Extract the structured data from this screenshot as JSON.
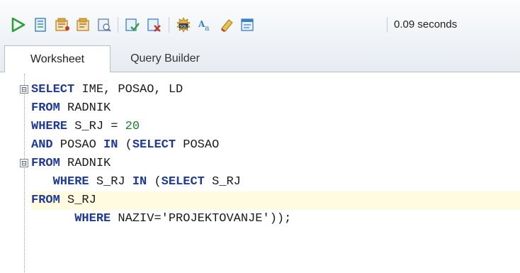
{
  "toolbar": {
    "buttons": [
      {
        "name": "run-statement-icon",
        "color": "#2f9e3a"
      },
      {
        "name": "run-script-icon",
        "color": "#3b7fc4"
      },
      {
        "name": "autotrace-icon",
        "color": "#c9962b"
      },
      {
        "name": "explain-plan-icon",
        "color": "#c9962b"
      },
      {
        "name": "sql-tuning-icon",
        "color": "#5f7fa8"
      },
      {
        "name": "commit-icon",
        "color": "#3b7fc4"
      },
      {
        "name": "rollback-icon",
        "color": "#c0392b"
      },
      {
        "name": "sql-history-icon",
        "color": "#c9962b"
      },
      {
        "name": "to-upper-lower-icon",
        "color": "#3b7fc4"
      },
      {
        "name": "clear-icon",
        "color": "#d4a12a"
      },
      {
        "name": "unshared-worksheet-icon",
        "color": "#3b7fc4"
      }
    ],
    "elapsed": "0.09 seconds"
  },
  "tabs": [
    {
      "label": "Worksheet",
      "active": true
    },
    {
      "label": "Query Builder",
      "active": false
    }
  ],
  "editor": {
    "lines": [
      [
        {
          "t": "SELECT",
          "c": "kw"
        },
        {
          "t": " IME, POSAO, LD",
          "c": "id"
        }
      ],
      [
        {
          "t": "FROM",
          "c": "kw"
        },
        {
          "t": " RADNIK",
          "c": "id"
        }
      ],
      [
        {
          "t": "WHERE",
          "c": "kw"
        },
        {
          "t": " S_RJ = ",
          "c": "id"
        },
        {
          "t": "20",
          "c": "num"
        }
      ],
      [
        {
          "t": "AND",
          "c": "kw"
        },
        {
          "t": " POSAO ",
          "c": "id"
        },
        {
          "t": "IN",
          "c": "kw"
        },
        {
          "t": " (",
          "c": "id"
        },
        {
          "t": "SELECT",
          "c": "kw"
        },
        {
          "t": " POSAO",
          "c": "id"
        }
      ],
      [
        {
          "t": "FROM",
          "c": "kw"
        },
        {
          "t": " RADNIK",
          "c": "id"
        }
      ],
      [
        {
          "t": "   ",
          "c": "id"
        },
        {
          "t": "WHERE",
          "c": "kw"
        },
        {
          "t": " S_RJ ",
          "c": "id"
        },
        {
          "t": "IN",
          "c": "kw"
        },
        {
          "t": " (",
          "c": "id"
        },
        {
          "t": "SELECT",
          "c": "kw"
        },
        {
          "t": " S_RJ",
          "c": "id"
        }
      ],
      [
        {
          "t": "FROM",
          "c": "kw"
        },
        {
          "t": " S_RJ",
          "c": "id"
        }
      ],
      [
        {
          "t": "      ",
          "c": "id"
        },
        {
          "t": "WHERE",
          "c": "kw"
        },
        {
          "t": " NAZIV=",
          "c": "id"
        },
        {
          "t": "'PROJEKTOVANJE'",
          "c": "str"
        },
        {
          "t": "));",
          "c": "id"
        }
      ]
    ],
    "highlighted_line": 6,
    "fold_markers": [
      "⊟",
      "⊟"
    ]
  }
}
